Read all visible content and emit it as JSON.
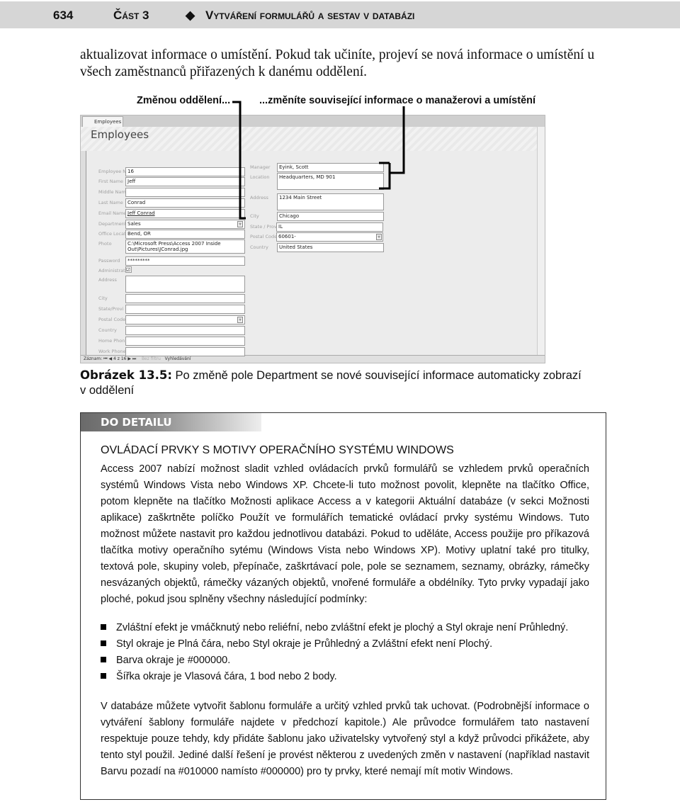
{
  "header": {
    "page_number": "634",
    "part": "Část 3",
    "separator_icon": "diamond-icon",
    "title": "Vytváření formulářů a sestav v databázi"
  },
  "intro": "aktualizovat informace o umístění. Pokud tak učiníte, projeví se nová informace o umístění u všech zaměstnanců přiřazených k danému oddělení.",
  "callouts": {
    "left": "Změnou oddělení...",
    "right": "...změníte související informace o manažerovi a umístění"
  },
  "form": {
    "tab": "Employees",
    "title": "Employees",
    "left": [
      {
        "label": "Employee N",
        "value": "16"
      },
      {
        "label": "First Name",
        "value": "Jeff"
      },
      {
        "label": "Middle Nam",
        "value": ""
      },
      {
        "label": "Last Name",
        "value": "Conrad"
      },
      {
        "label": "Email Name",
        "value": "Jeff Conrad"
      },
      {
        "label": "Department",
        "value": "Sales"
      },
      {
        "label": "Office Locat",
        "value": "Bend, OR"
      },
      {
        "label": "Photo",
        "value": "C:\\Microsoft Press\\Access 2007 Inside Out\\Pictures\\JConrad.jpg"
      },
      {
        "label": "Password",
        "value": "*********"
      },
      {
        "label": "Administrat",
        "value": "☑"
      },
      {
        "label": "Address",
        "value": ""
      },
      {
        "label": "City",
        "value": ""
      },
      {
        "label": "State/Provi",
        "value": ""
      },
      {
        "label": "Postal Code",
        "value": ""
      },
      {
        "label": "Country",
        "value": ""
      },
      {
        "label": "Home Phon",
        "value": ""
      },
      {
        "label": "Work Phone",
        "value": ""
      }
    ],
    "right": [
      {
        "label": "Manager",
        "value": "Eyink, Scott"
      },
      {
        "label": "Location",
        "value": "Headquarters, MD 901"
      },
      {
        "label": "Address",
        "value": "1234 Main Street"
      },
      {
        "label": "City",
        "value": "Chicago"
      },
      {
        "label": "State / Prov",
        "value": "IL"
      },
      {
        "label": "Postal Code",
        "value": "60601-"
      },
      {
        "label": "Country",
        "value": "United States"
      }
    ],
    "nav": {
      "record_label": "Záznam:",
      "position": "4 z 16",
      "filter": "Bez filtru",
      "search": "Vyhledávání"
    }
  },
  "caption": {
    "label": "Obrázek 13.5:",
    "text": " Po změně pole Department se nové související informace automaticky zobrazí v oddělení"
  },
  "sidebar": {
    "tag": "DO DETAILU",
    "heading": "OVLÁDACÍ PRVKY S MOTIVY OPERAČNÍHO SYSTÉMU WINDOWS",
    "p1": "Access 2007 nabízí možnost sladit vzhled ovládacích prvků formulářů se vzhledem prvků operačních systémů Windows Vista nebo Windows XP. Chcete-li tuto možnost povolit, klepněte na tlačítko Office, potom klepněte na tlačítko Možnosti aplikace Access a v kategorii Aktuální databáze (v sekci Možnosti aplikace) zaškrtněte políčko Použít ve formulářích tematické ovládací prvky systému Windows. Tuto možnost můžete nastavit pro každou jednotlivou databázi. Pokud to uděláte, Access použije pro příkazová tlačítka motivy operačního sytému (Windows Vista nebo Windows XP). Motivy uplatní také pro titulky, textová pole, skupiny voleb, přepínače, zaškrtávací pole, pole se seznamem, seznamy, obrázky, rámečky nesvázaných objektů, rámečky vázaných objektů, vnořené formuláře a obdélníky. Tyto prvky vypadají jako ploché, pokud jsou splněny všechny následující podmínky:",
    "bullets": [
      "Zvláštní efekt je vmáčknutý nebo reliéfní, nebo zvláštní efekt je plochý a Styl okraje není Průhledný.",
      "Styl okraje je Plná čára, nebo Styl okraje je Průhledný a Zvláštní efekt není Plochý.",
      "Barva okraje je #000000.",
      "Šířka okraje je Vlasová čára, 1 bod nebo 2 body."
    ],
    "p2": "V databáze můžete vytvořit šablonu formuláře a určitý vzhled prvků tak uchovat. (Podrobnější informace o vytváření šablony formuláře najdete v předchozí kapitole.) Ale průvodce formulářem tato nastavení respektuje pouze tehdy, kdy přidáte šablonu jako uživatelsky vytvořený styl a když průvodci přikážete, aby tento styl použil. Jediné další řešení je provést některou z uvedených změn v nastavení (například nastavit Barvu pozadí na #010000 namísto #000000) pro ty prvky, které nemají mít motiv Windows."
  }
}
